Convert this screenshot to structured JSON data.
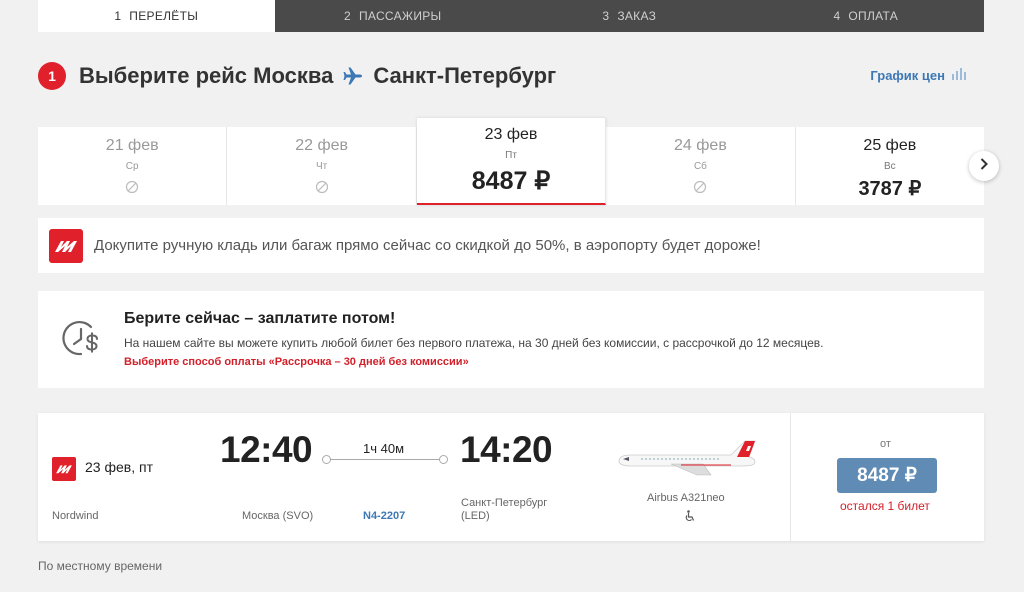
{
  "steps": [
    {
      "num": "1",
      "label": "ПЕРЕЛЁТЫ",
      "active": true
    },
    {
      "num": "2",
      "label": "ПАССАЖИРЫ",
      "active": false
    },
    {
      "num": "3",
      "label": "ЗАКАЗ",
      "active": false
    },
    {
      "num": "4",
      "label": "ОПЛАТА",
      "active": false
    }
  ],
  "heading": {
    "step_number": "1",
    "prefix": "Выберите рейс Москва",
    "destination": "Санкт-Петербург",
    "price_chart_label": "График цен"
  },
  "dates": [
    {
      "date": "21 фев",
      "weekday": "Ср",
      "price": null
    },
    {
      "date": "22 фев",
      "weekday": "Чт",
      "price": null
    },
    {
      "date": "23 фев",
      "weekday": "Пт",
      "price": "8487 ₽"
    },
    {
      "date": "24 фев",
      "weekday": "Сб",
      "price": null
    },
    {
      "date": "25 фев",
      "weekday": "Вс",
      "price": "3787 ₽"
    }
  ],
  "promo": {
    "text": "Докупите ручную кладь или багаж прямо сейчас со скидкой до 50%, в аэропорту будет дороже!"
  },
  "paylater": {
    "title": "Берите сейчас – заплатите потом!",
    "description": "На нашем сайте вы можете купить любой билет без первого платежа, на 30 дней без комиссии, с рассрочкой до 12 месяцев.",
    "link": "Выберите способ оплаты «Рассрочка – 30 дней без комиссии»"
  },
  "flight": {
    "date": "23 фев, пт",
    "airline": "Nordwind",
    "departure_time": "12:40",
    "arrival_time": "14:20",
    "duration": "1ч 40м",
    "from": "Москва (SVO)",
    "to_line1": "Санкт-Петербург",
    "to_line2": "(LED)",
    "flight_number": "N4-2207",
    "aircraft": "Airbus A321neo",
    "price_from_label": "от",
    "price": "8487 ₽",
    "seats_left": "остался 1 билет"
  },
  "footnote": "По местному времени",
  "colors": {
    "accent_red": "#e0202b",
    "link_blue": "#3d78b5",
    "price_button": "#5f8bb4",
    "steps_bar": "#4a4a4a"
  },
  "icons": {
    "plane": "plane-icon",
    "unavailable": "unavailable-icon",
    "next": "chevron-right-icon",
    "chart": "bar-chart-icon",
    "pay_later": "clock-dollar-icon",
    "wheelchair": "wheelchair-icon"
  }
}
